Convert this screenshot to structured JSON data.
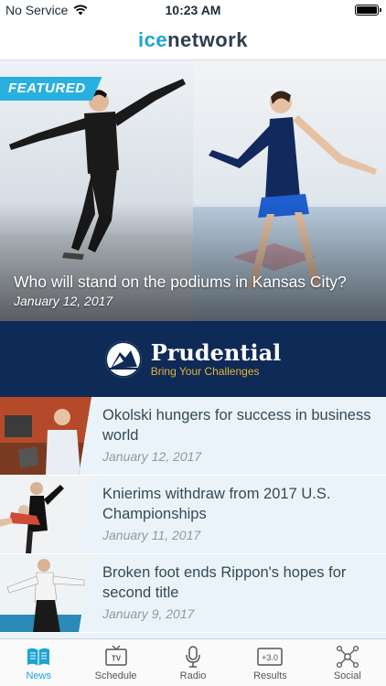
{
  "status_bar": {
    "carrier": "No Service",
    "time": "10:23 AM"
  },
  "header": {
    "logo_part1": "ice",
    "logo_part2": "network"
  },
  "featured": {
    "badge": "FEATURED",
    "title": "Who will stand on the podiums in Kansas City?",
    "date": "January 12, 2017"
  },
  "ad": {
    "brand": "Prudential",
    "tagline": "Bring Your Challenges"
  },
  "news": [
    {
      "title": "Okolski hungers for success in business world",
      "date": "January 12, 2017"
    },
    {
      "title": "Knierims withdraw from 2017 U.S. Championships",
      "date": "January 11, 2017"
    },
    {
      "title": "Broken foot ends Rippon's hopes for second title",
      "date": "January 9, 2017"
    }
  ],
  "tabs": [
    {
      "label": "News",
      "icon": "news-icon",
      "active": true
    },
    {
      "label": "Schedule",
      "icon": "tv-icon",
      "active": false
    },
    {
      "label": "Radio",
      "icon": "microphone-icon",
      "active": false
    },
    {
      "label": "Results",
      "icon": "scoreboard-icon",
      "active": false,
      "icon_text": "+3.0"
    },
    {
      "label": "Social",
      "icon": "network-icon",
      "active": false
    }
  ],
  "colors": {
    "accent": "#1fa3d4",
    "ad_background": "#0e2a56",
    "ad_tagline": "#e2b43a",
    "list_background": "#eaf3f9"
  }
}
